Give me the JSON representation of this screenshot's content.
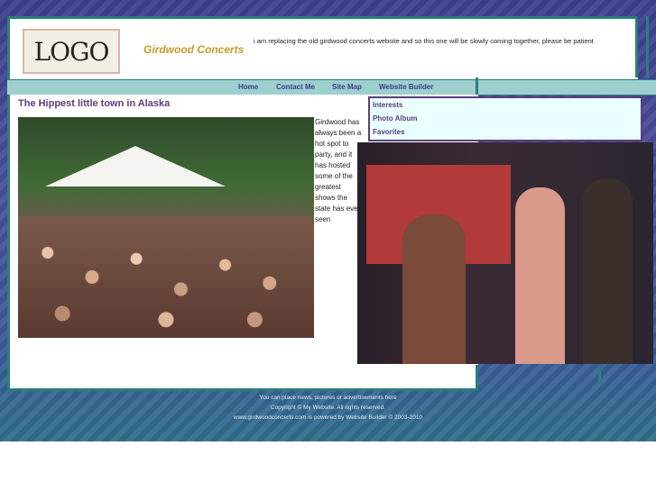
{
  "header": {
    "logo_text": "LOGO",
    "site_name": "Girdwood Concerts",
    "notice": "i am replacing the old girdwood concerts website and so this one will be slowly coming together, please be patient"
  },
  "nav": {
    "items": [
      "Home",
      "Contact Me",
      "Site Map",
      "Website Builder"
    ]
  },
  "main": {
    "title": "The Hippest little town in Alaska",
    "intro": "Girdwood has always been a hot spot to party, and it has hosted some of the greatest shows the state has ever seen"
  },
  "sidebar": {
    "items": [
      "Interests",
      "Photo Album",
      "Favorites"
    ]
  },
  "footer": {
    "line1": "You can place news, pictures or advertisements here",
    "line2": "Copyright © My Website. All rights reserved.",
    "line3": "www.girdwoodconcerts.com is powered by Website Builder © 2003-2010"
  }
}
